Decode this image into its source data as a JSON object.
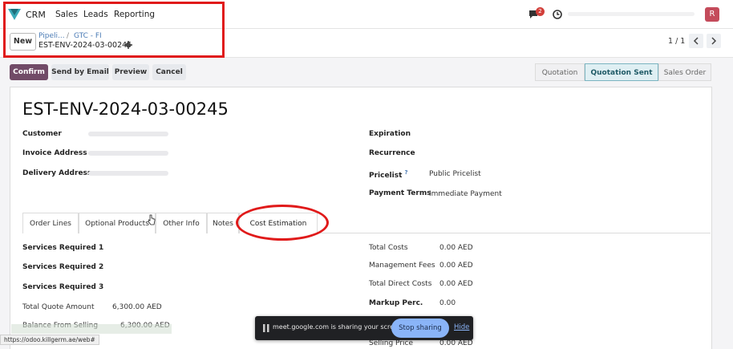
{
  "navbar": {
    "app_name": "CRM",
    "menu": [
      "Sales",
      "Leads",
      "Reporting"
    ],
    "chat_badge": "2",
    "avatar_letter": "R"
  },
  "control": {
    "new_label": "New",
    "breadcrumb": [
      "Pipeli...",
      "GTC - FI"
    ],
    "record_name": "EST-ENV-2024-03-00245",
    "pager": "1 / 1"
  },
  "actions": {
    "confirm": "Confirm",
    "send_email": "Send by Email",
    "preview": "Preview",
    "cancel": "Cancel"
  },
  "status": {
    "steps": [
      "Quotation",
      "Quotation Sent",
      "Sales Order"
    ],
    "active": "Quotation Sent"
  },
  "form": {
    "title": "EST-ENV-2024-03-00245",
    "left_labels": [
      "Customer",
      "Invoice Address",
      "Delivery Address"
    ],
    "right_labels": [
      "Expiration",
      "Recurrence",
      "Pricelist",
      "Payment Terms"
    ],
    "pricelist_tooltip": "?",
    "pricelist_value": "Public Pricelist",
    "payment_terms_value": "Immediate Payment"
  },
  "tabs": [
    "Order Lines",
    "Optional Products",
    "Other Info",
    "Notes",
    "Cost Estimation"
  ],
  "cost_left": {
    "labels": [
      "Services Required 1",
      "Services Required 2",
      "Services Required 3"
    ],
    "total_quote_label": "Total Quote Amount",
    "total_quote_value": "6,300.00 AED",
    "balance_label": "Balance From Selling",
    "balance_value": "6,300.00 AED"
  },
  "cost_right": {
    "rows": [
      {
        "label": "Total Costs",
        "value": "0.00 AED"
      },
      {
        "label": "Management Fees",
        "value": "0.00 AED"
      },
      {
        "label": "Total Direct Costs",
        "value": "0.00 AED"
      }
    ],
    "markup_label": "Markup Perc.",
    "markup_value": "0.00",
    "selling_label": "Selling Price",
    "selling_value": "0.00 AED"
  },
  "share_bar": {
    "text": "meet.google.com is sharing your screen.",
    "stop": "Stop sharing",
    "hide": "Hide"
  },
  "status_url": "https://odoo.killgerm.ae/web#",
  "colors": {
    "primary": "#714b67",
    "annotation_red": "#e01a1a",
    "link": "#4b7bb5"
  }
}
